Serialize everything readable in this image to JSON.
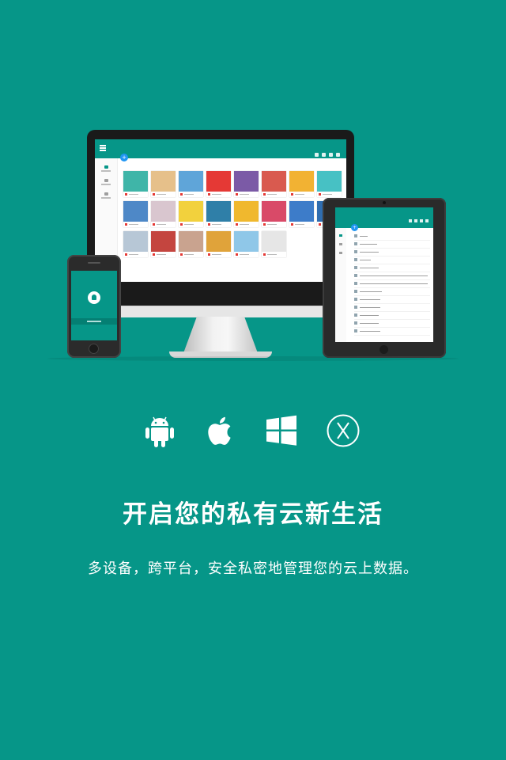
{
  "headline": "开启您的私有云新生活",
  "subline": "多设备，跨平台，安全私密地管理您的云上数据。",
  "platform_icons": [
    "android-icon",
    "apple-icon",
    "windows-icon",
    "osx-icon"
  ],
  "colors": {
    "background": "#069688",
    "accent": "#069688",
    "fab": "#2196f3",
    "text": "#ffffff"
  },
  "photo_tiles": [
    "#3fb5a8",
    "#e6c08a",
    "#5fa5d9",
    "#e53935",
    "#7b5aa6",
    "#d95a4f",
    "#f2b233",
    "#47c1c4",
    "#4e88c7",
    "#d9c6cf",
    "#f2d13d",
    "#2f7fa8",
    "#f0b82e",
    "#d94a68",
    "#3d7cc9",
    "#2f6db0",
    "#b7c7d6",
    "#c4453f",
    "#c9a38f",
    "#e0a33a",
    "#8fc7e8",
    "#e6e6e6"
  ]
}
